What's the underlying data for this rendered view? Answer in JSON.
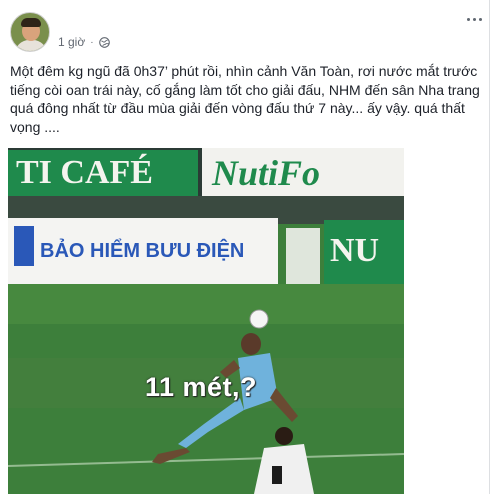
{
  "post": {
    "timestamp": "1 giờ",
    "separator": "·",
    "privacy_icon": "globe-icon",
    "menu_icon": "more-options-icon",
    "text": "Một đêm kg ngũ đã 0h37’ phút rồi, nhìn cảnh Văn Toàn, rơi nước mắt trước tiếng còi oan trái này, cố gắng làm tốt cho giải đấu, NHM đến sân Nha trang quá đông nhất từ đầu mùa giải đến vòng đấu thứ 7 này... ấy vậy. quá thất vọng ...."
  },
  "image": {
    "overlay_caption": "11 mét,?",
    "banner_top_left": "TI CAFÉ",
    "banner_top_right": "NutiFo",
    "banner_middle": "BẢO HIỂM BƯU ĐIỆN",
    "banner_middle_right": "NU"
  },
  "colors": {
    "text": "#1d2129",
    "meta": "#616770",
    "pitch_green": "#3d7f3b",
    "banner_green": "#1f8a4c"
  }
}
